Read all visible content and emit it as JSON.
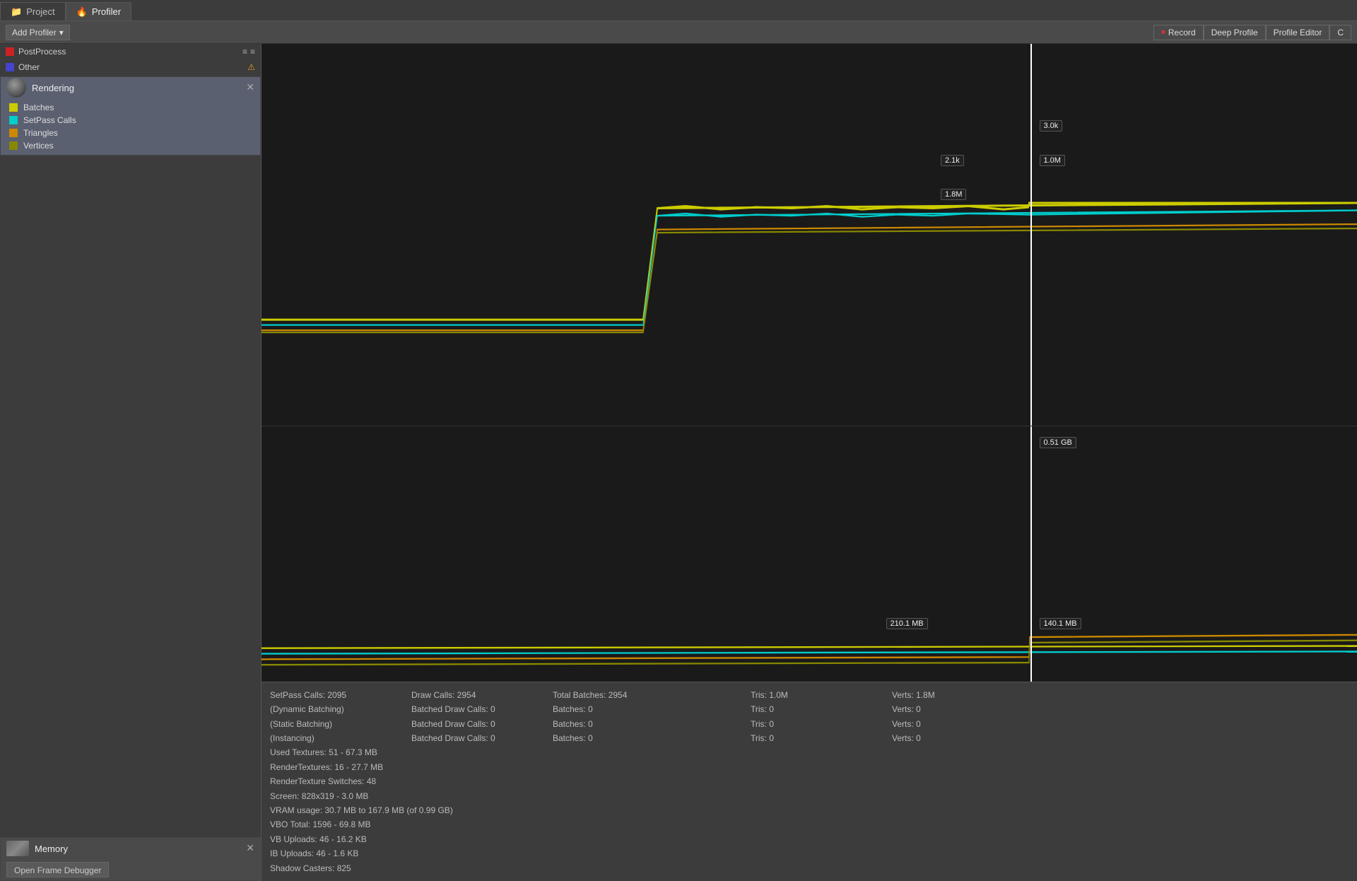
{
  "tabs": [
    {
      "id": "project",
      "label": "Project",
      "icon": "📁",
      "active": false
    },
    {
      "id": "profiler",
      "label": "Profiler",
      "icon": "🔥",
      "active": true
    }
  ],
  "toolbar": {
    "add_profiler_label": "Add Profiler",
    "record_label": "Record",
    "deep_profile_label": "Deep Profile",
    "profile_editor_label": "Profile Editor",
    "clear_label": "C"
  },
  "profiler_items": [
    {
      "id": "postprocess",
      "label": "PostProcess",
      "color": "#cc2222"
    },
    {
      "id": "other",
      "label": "Other",
      "color": "#4444cc"
    }
  ],
  "rendering_section": {
    "title": "Rendering",
    "legend": [
      {
        "id": "batches",
        "label": "Batches",
        "color": "#cccc00"
      },
      {
        "id": "setpass_calls",
        "label": "SetPass Calls",
        "color": "#00cccc"
      },
      {
        "id": "triangles",
        "label": "Triangles",
        "color": "#cc8800"
      },
      {
        "id": "vertices",
        "label": "Vertices",
        "color": "#888800"
      }
    ]
  },
  "memory_section": {
    "title": "Memory",
    "open_frame_debugger_label": "Open Frame Debugger"
  },
  "chart": {
    "rendering_labels": [
      {
        "id": "val_3k",
        "text": "3.0k",
        "x_pct": 70.2,
        "y_pct": 22
      },
      {
        "id": "val_21k",
        "text": "2.1k",
        "x_pct": 63.5,
        "y_pct": 30
      },
      {
        "id": "val_1m",
        "text": "1.0M",
        "x_pct": 70.2,
        "y_pct": 30
      },
      {
        "id": "val_18m",
        "text": "1.8M",
        "x_pct": 63.5,
        "y_pct": 38
      }
    ],
    "memory_labels": [
      {
        "id": "mem_051gb",
        "text": "0.51 GB",
        "x_pct": 70.2,
        "y_pct": 5
      },
      {
        "id": "mem_2101mb",
        "text": "210.1 MB",
        "x_pct": 57.5,
        "y_pct": 77
      },
      {
        "id": "mem_1401mb",
        "text": "140.1 MB",
        "x_pct": 70.2,
        "y_pct": 77
      }
    ],
    "cursor_x_pct": 70.2
  },
  "stats": {
    "line1": {
      "setpass": "SetPass Calls: 2095",
      "draw_calls": "Draw Calls: 2954",
      "total_batches": "Total Batches: 2954",
      "tris": "Tris: 1.0M",
      "verts": "Verts: 1.8M"
    },
    "line2": {
      "label": "(Dynamic Batching)",
      "batched_draw": "Batched Draw Calls: 0",
      "batches": "Batches: 0",
      "tris": "Tris: 0",
      "verts": "Verts: 0"
    },
    "line3": {
      "label": "(Static Batching)",
      "batched_draw": "Batched Draw Calls: 0",
      "batches": "Batches: 0",
      "tris": "Tris: 0",
      "verts": "Verts: 0"
    },
    "line4": {
      "label": "(Instancing)",
      "batched_draw": "Batched Draw Calls: 0",
      "batches": "Batches: 0",
      "tris": "Tris: 0",
      "verts": "Verts: 0"
    },
    "used_textures": "Used Textures: 51 - 67.3 MB",
    "render_textures": "RenderTextures: 16 - 27.7 MB",
    "rt_switches": "RenderTexture Switches: 48",
    "screen": "Screen: 828x319 - 3.0 MB",
    "vram": "VRAM usage: 30.7 MB to 167.9 MB (of 0.99 GB)",
    "vbo_total": "VBO Total: 1596 - 69.8 MB",
    "vb_uploads": "VB Uploads: 46 - 16.2 KB",
    "ib_uploads": "IB Uploads: 46 - 1.6 KB",
    "shadow_casters": "Shadow Casters: 825"
  }
}
